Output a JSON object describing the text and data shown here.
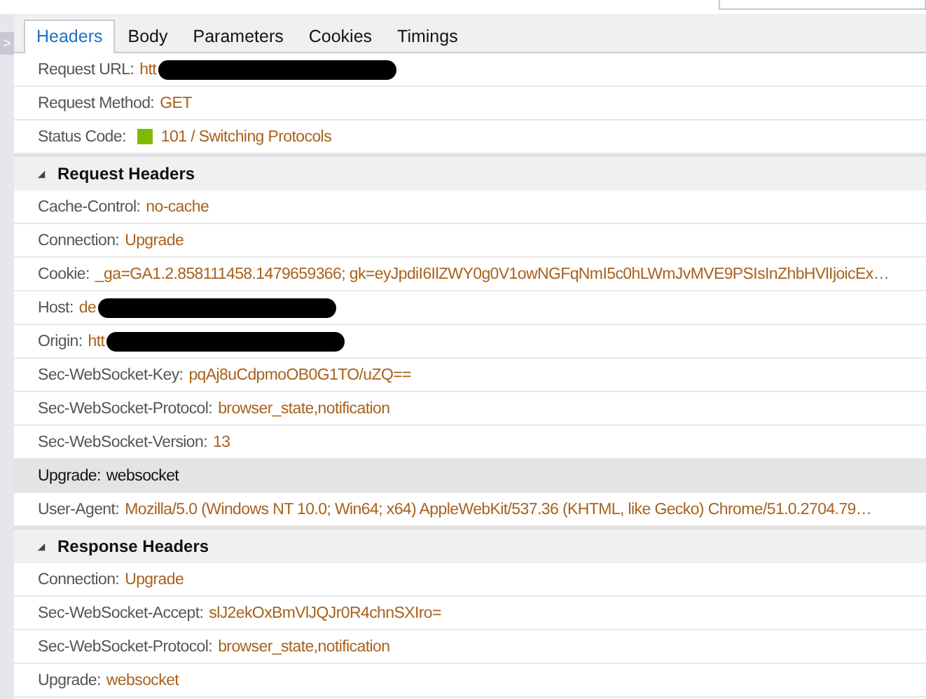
{
  "sidebar_toggle": ">",
  "tabs": [
    {
      "label": "Headers",
      "selected": true
    },
    {
      "label": "Body",
      "selected": false
    },
    {
      "label": "Parameters",
      "selected": false
    },
    {
      "label": "Cookies",
      "selected": false
    },
    {
      "label": "Timings",
      "selected": false
    }
  ],
  "sections": [
    {
      "kind": "plain",
      "rows": [
        {
          "name": "Request URL:",
          "value": "htt",
          "redacted": true,
          "selected": false
        },
        {
          "name": "Request Method:",
          "value": "GET",
          "redacted": false,
          "selected": false
        },
        {
          "name": "Status Code:",
          "value": "101 / Switching Protocols",
          "color": "#7fba00",
          "redacted": false,
          "selected": false
        }
      ]
    },
    {
      "kind": "group",
      "title": "Request Headers",
      "expanded": true,
      "rows": [
        {
          "name": "Cache-Control:",
          "value": "no-cache",
          "redacted": false,
          "selected": false
        },
        {
          "name": "Connection:",
          "value": "Upgrade",
          "redacted": false,
          "selected": false
        },
        {
          "name": "Cookie:",
          "value": "_ga=GA1.2.858111458.1479659366; gk=eyJpdiI6IlZWY0g0V1owNGFqNmI5c0hLWmJvMVE9PSIsInZhbHVlIjoicEx…",
          "redacted": false,
          "selected": false
        },
        {
          "name": "Host:",
          "value": "de",
          "redacted": true,
          "selected": false
        },
        {
          "name": "Origin:",
          "value": "htt",
          "redacted": true,
          "selected": false
        },
        {
          "name": "Sec-WebSocket-Key:",
          "value": "pqAj8uCdpmoOB0G1TO/uZQ==",
          "redacted": false,
          "selected": false
        },
        {
          "name": "Sec-WebSocket-Protocol:",
          "value": "browser_state,notification",
          "redacted": false,
          "selected": false
        },
        {
          "name": "Sec-WebSocket-Version:",
          "value": "13",
          "redacted": false,
          "selected": false
        },
        {
          "name": "Upgrade:",
          "value": "websocket",
          "redacted": false,
          "selected": true
        },
        {
          "name": "User-Agent:",
          "value": "Mozilla/5.0 (Windows NT 10.0; Win64; x64) AppleWebKit/537.36 (KHTML, like Gecko) Chrome/51.0.2704.79…",
          "redacted": false,
          "selected": false
        }
      ]
    },
    {
      "kind": "group",
      "title": "Response Headers",
      "expanded": true,
      "rows": [
        {
          "name": "Connection:",
          "value": "Upgrade",
          "redacted": false,
          "selected": false
        },
        {
          "name": "Sec-WebSocket-Accept:",
          "value": "slJ2ekOxBmVlJQJr0R4chnSXIro=",
          "redacted": false,
          "selected": false
        },
        {
          "name": "Sec-WebSocket-Protocol:",
          "value": "browser_state,notification",
          "redacted": false,
          "selected": false
        },
        {
          "name": "Upgrade:",
          "value": "websocket",
          "redacted": false,
          "selected": false
        }
      ]
    }
  ]
}
